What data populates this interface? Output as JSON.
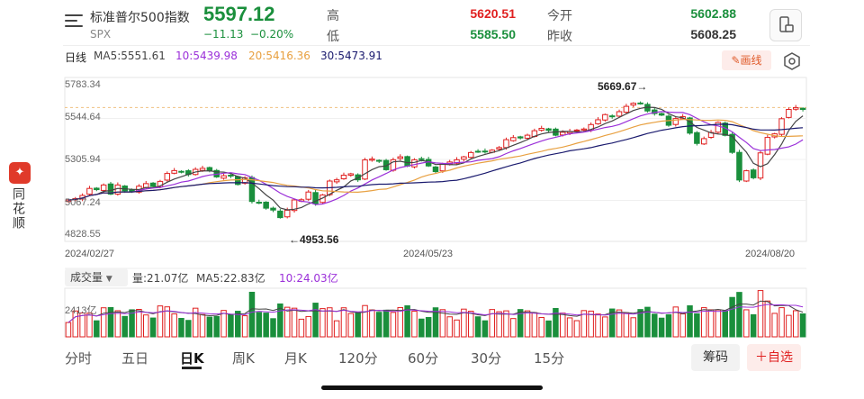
{
  "header": {
    "title": "标准普尔500指数",
    "symbol": "SPX",
    "price": "5597.12",
    "change": "−11.13",
    "change_pct": "−0.20%",
    "quote": {
      "high_label": "高",
      "high": "5620.51",
      "low_label": "低",
      "low": "5585.50",
      "open_label": "今开",
      "open": "5602.88",
      "prev_label": "昨收",
      "prev": "5608.25"
    }
  },
  "colors": {
    "up": "#e02020",
    "down": "#1a8f3c",
    "ma5": "#444444",
    "ma10": "#9b30d9",
    "ma20": "#e8a040",
    "ma30": "#1a1a6e"
  },
  "ma_legend": {
    "period_label": "日线",
    "ma5": "MA5:5551.61",
    "ma10": "10:5439.98",
    "ma20": "20:5416.36",
    "ma30": "30:5473.91"
  },
  "toolbar": {
    "draw_label": "画线",
    "draw_icon": "pencil-icon",
    "settings_icon": "settings-icon",
    "landscape_icon": "landscape-icon",
    "menu_icon": "menu-icon"
  },
  "sidebar": {
    "logo": "✦",
    "text": "同花顺"
  },
  "chart_data": {
    "type": "candlestick",
    "y_ticks": [
      "5783.34",
      "5544.64",
      "5305.94",
      "5067.24",
      "4828.55"
    ],
    "ylim": [
      4828.55,
      5783.34
    ],
    "dates": [
      "2024/02/27",
      "2024/05/23",
      "2024/08/20"
    ],
    "annotations": {
      "high": "5669.67→",
      "low": "←4953.56"
    },
    "volume": {
      "selector": "成交量",
      "vol": "量:21.07亿",
      "ma5": "MA5:22.83亿",
      "ma10": "10:24.03亿",
      "axis_label": "2413亿"
    },
    "close": [
      5069,
      5078,
      5096,
      5137,
      5130,
      5157,
      5104,
      5157,
      5123,
      5117,
      5150,
      5165,
      5149,
      5178,
      5224,
      5241,
      5234,
      5218,
      5248,
      5254,
      5243,
      5204,
      5211,
      5209,
      5160,
      5199,
      5061,
      5051,
      5022,
      5011,
      4967,
      5010,
      5070,
      5071,
      5116,
      5048,
      5099,
      5180,
      5187,
      5214,
      5222,
      5187,
      5303,
      5308,
      5297,
      5246,
      5304,
      5321,
      5267,
      5304,
      5306,
      5268,
      5235,
      5278,
      5291,
      5304,
      5321,
      5346,
      5353,
      5352,
      5360,
      5375,
      5421,
      5433,
      5431,
      5447,
      5473,
      5487,
      5475,
      5447,
      5464,
      5469,
      5477,
      5483,
      5509,
      5537,
      5567,
      5555,
      5584,
      5615,
      5633,
      5631,
      5588,
      5573,
      5564,
      5505,
      5544,
      5555,
      5459,
      5399,
      5427,
      5463,
      5522,
      5446,
      5347,
      5186,
      5240,
      5199,
      5344,
      5434,
      5455,
      5543,
      5597,
      5608,
      5597
    ]
  },
  "tabs": [
    "分时",
    "五日",
    "日K",
    "周K",
    "月K",
    "120分",
    "60分",
    "30分",
    "15分"
  ],
  "active_tab": "日K",
  "buttons": {
    "chip": "筹码",
    "watchlist": "＋自选"
  }
}
